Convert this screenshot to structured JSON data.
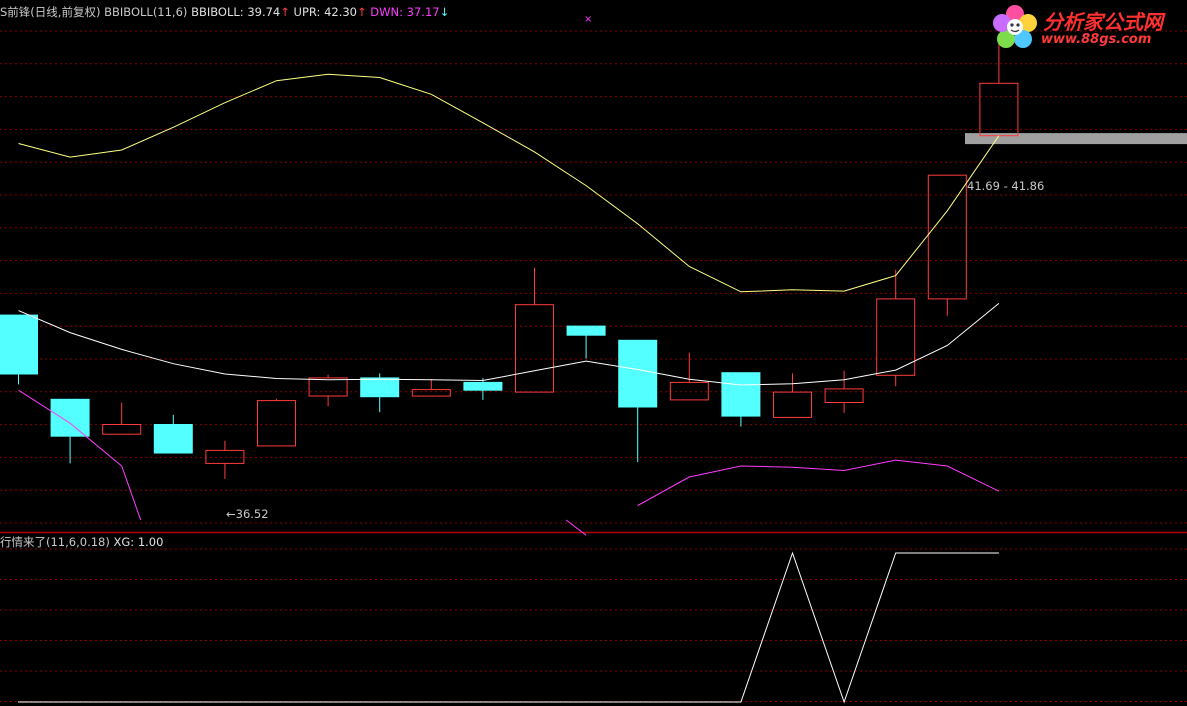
{
  "header_main": {
    "title": "S前锋(日线,前复权)",
    "indicator_name": "BBIBOLL(11,6)",
    "bbiboll_label": "BBIBOLL: 39.74",
    "upr_label": "UPR: 42.30",
    "dwn_label": "DWN: 37.17",
    "cross_marker": "×"
  },
  "header_sub": {
    "title": "行情来了(11,6,0.18)",
    "xg_label": "XG: 1.00"
  },
  "logo": {
    "title": "分析家公式网",
    "url": "www.88gs.com"
  },
  "annotations": {
    "low_label": "36.52",
    "price_range_label": "41.69 - 41.86"
  },
  "colors": {
    "background": "#000000",
    "grid": "#8b0000",
    "panel_border": "#b00000",
    "up_candle": "#ff3b3b",
    "down_candle": "#54ffff",
    "bbiboll_line": "#ffffff",
    "upr_line": "#ffff80",
    "dwn_line": "#ff3cff",
    "xg_line": "#ffffff",
    "highlight_bar": "#a0a0a0"
  },
  "chart_data": [
    {
      "type": "candlestick",
      "title": "S前锋(日线,前复权)",
      "ylim": [
        35.7,
        43.7
      ],
      "grid": true,
      "candles": [
        {
          "open": 39.05,
          "close": 38.14,
          "high": 39.05,
          "low": 37.98
        },
        {
          "open": 37.75,
          "close": 37.18,
          "high": 37.75,
          "low": 36.76
        },
        {
          "open": 37.21,
          "close": 37.36,
          "high": 37.7,
          "low": 37.21
        },
        {
          "open": 37.36,
          "close": 36.92,
          "high": 37.51,
          "low": 36.92
        },
        {
          "open": 36.76,
          "close": 36.96,
          "high": 37.11,
          "low": 36.52
        },
        {
          "open": 37.03,
          "close": 37.73,
          "high": 37.76,
          "low": 37.03
        },
        {
          "open": 37.8,
          "close": 38.08,
          "high": 38.13,
          "low": 37.64
        },
        {
          "open": 38.08,
          "close": 37.79,
          "high": 38.15,
          "low": 37.55
        },
        {
          "open": 37.8,
          "close": 37.9,
          "high": 38.06,
          "low": 37.8
        },
        {
          "open": 38.01,
          "close": 37.89,
          "high": 38.08,
          "low": 37.74
        },
        {
          "open": 37.86,
          "close": 39.21,
          "high": 39.78,
          "low": 37.86
        },
        {
          "open": 38.88,
          "close": 38.74,
          "high": 38.88,
          "low": 38.38
        },
        {
          "open": 38.66,
          "close": 37.63,
          "high": 38.66,
          "low": 36.78
        },
        {
          "open": 37.74,
          "close": 38.01,
          "high": 38.47,
          "low": 37.74
        },
        {
          "open": 38.16,
          "close": 37.49,
          "high": 38.16,
          "low": 37.33
        },
        {
          "open": 37.47,
          "close": 37.86,
          "high": 38.15,
          "low": 37.47
        },
        {
          "open": 37.7,
          "close": 37.91,
          "high": 38.19,
          "low": 37.54
        },
        {
          "open": 38.12,
          "close": 39.3,
          "high": 39.75,
          "low": 37.95
        },
        {
          "open": 39.3,
          "close": 41.21,
          "high": 41.21,
          "low": 39.04
        },
        {
          "open": 41.82,
          "close": 42.63,
          "high": 43.34,
          "low": 41.82
        }
      ],
      "series": [
        {
          "name": "BBIBOLL",
          "values": [
            39.12,
            38.78,
            38.52,
            38.3,
            38.14,
            38.07,
            38.05,
            38.06,
            38.05,
            38.04,
            38.19,
            38.34,
            38.21,
            38.06,
            37.97,
            37.99,
            38.05,
            38.2,
            38.58,
            39.23
          ]
        },
        {
          "name": "UPR",
          "values": [
            41.7,
            41.49,
            41.6,
            41.95,
            42.33,
            42.67,
            42.77,
            42.72,
            42.46,
            42.02,
            41.57,
            41.05,
            40.46,
            39.8,
            39.41,
            39.44,
            39.42,
            39.66,
            40.66,
            41.82
          ]
        },
        {
          "name": "DWN",
          "values": [
            37.89,
            37.38,
            36.72,
            null,
            null,
            null,
            null,
            null,
            null,
            null,
            null,
            35.65,
            36.11,
            36.55,
            36.72,
            36.7,
            36.65,
            36.81,
            36.72,
            36.33
          ]
        }
      ]
    },
    {
      "type": "line",
      "title": "行情来了(11,6,0.18)",
      "ylim": [
        0,
        1
      ],
      "series": [
        {
          "name": "XG",
          "values": [
            0,
            0,
            0,
            0,
            0,
            0,
            0,
            0,
            0,
            0,
            0,
            0,
            0,
            0,
            0,
            1,
            0,
            1,
            1,
            1
          ]
        }
      ]
    }
  ]
}
